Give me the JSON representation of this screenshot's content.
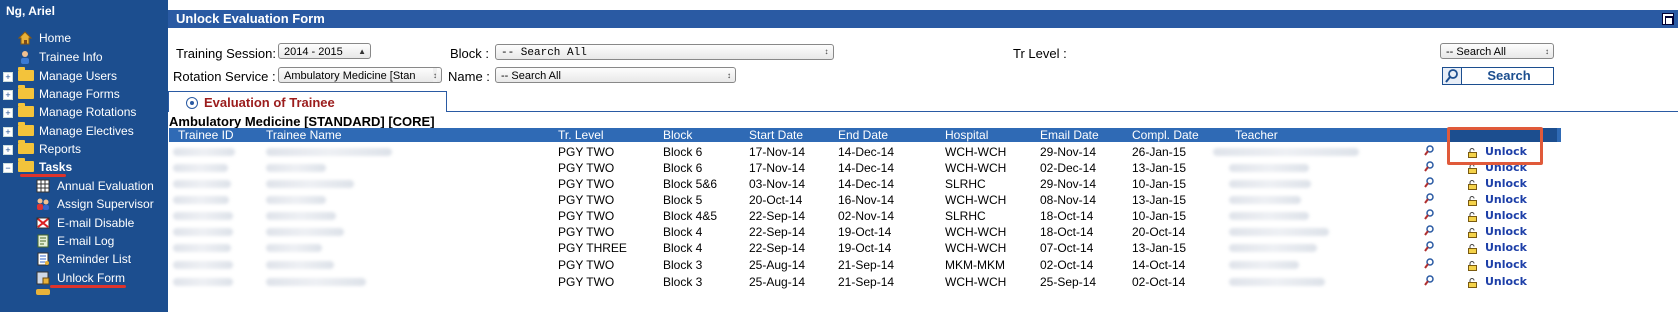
{
  "sidebar": {
    "user": "Ng, Ariel",
    "items": [
      {
        "label": "Home",
        "icon": "home-icon"
      },
      {
        "label": "Trainee Info",
        "icon": "person-icon"
      },
      {
        "label": "Manage Users",
        "icon": "folder-icon"
      },
      {
        "label": "Manage Forms",
        "icon": "folder-icon"
      },
      {
        "label": "Manage Rotations",
        "icon": "folder-icon"
      },
      {
        "label": "Manage Electives",
        "icon": "folder-icon"
      },
      {
        "label": "Reports",
        "icon": "folder-icon"
      },
      {
        "label": "Tasks",
        "icon": "folder-open-icon"
      },
      {
        "label": "Annual Evaluation",
        "icon": "grid-icon"
      },
      {
        "label": "Assign Supervisor",
        "icon": "users-icon"
      },
      {
        "label": "E-mail Disable",
        "icon": "mail-disable-icon"
      },
      {
        "label": "E-mail Log",
        "icon": "log-icon"
      },
      {
        "label": "Reminder List",
        "icon": "list-icon"
      },
      {
        "label": "Unlock Form",
        "icon": "unlock-form-icon"
      }
    ]
  },
  "title": "Unlock Evaluation Form",
  "filters": {
    "training_session_label": "Training Session:",
    "training_session_value": "2014 - 2015",
    "block_label": "Block :",
    "block_value": "-- Search All",
    "tr_level_label": "Tr Level :",
    "tr_level_value": "-- Search All",
    "rotation_service_label": "Rotation Service :",
    "rotation_service_value": "Ambulatory Medicine [Stan",
    "name_label": "Name :",
    "name_value": "-- Search All",
    "search_label": "Search"
  },
  "tab": {
    "label": "Evaluation of Trainee"
  },
  "section_title": "Ambulatory Medicine [STANDARD] [CORE]",
  "columns": [
    "Trainee ID",
    "Trainee Name",
    "Tr. Level",
    "Block",
    "Start Date",
    "End Date",
    "Hospital",
    "Email Date",
    "Compl. Date",
    "Teacher"
  ],
  "unlock_label": "Unlock",
  "rows": [
    {
      "level": "PGY TWO",
      "block": "Block 6",
      "start": "17-Nov-14",
      "end": "14-Dec-14",
      "hospital": "WCH-WCH",
      "email": "29-Nov-14",
      "compl": "26-Jan-15"
    },
    {
      "level": "PGY TWO",
      "block": "Block 6",
      "start": "17-Nov-14",
      "end": "14-Dec-14",
      "hospital": "WCH-WCH",
      "email": "02-Dec-14",
      "compl": "13-Jan-15"
    },
    {
      "level": "PGY TWO",
      "block": "Block 5&6",
      "start": "03-Nov-14",
      "end": "14-Dec-14",
      "hospital": "SLRHC",
      "email": "29-Nov-14",
      "compl": "10-Jan-15"
    },
    {
      "level": "PGY TWO",
      "block": "Block 5",
      "start": "20-Oct-14",
      "end": "16-Nov-14",
      "hospital": "WCH-WCH",
      "email": "08-Nov-14",
      "compl": "13-Jan-15"
    },
    {
      "level": "PGY TWO",
      "block": "Block 4&5",
      "start": "22-Sep-14",
      "end": "02-Nov-14",
      "hospital": "SLRHC",
      "email": "18-Oct-14",
      "compl": "10-Jan-15"
    },
    {
      "level": "PGY TWO",
      "block": "Block 4",
      "start": "22-Sep-14",
      "end": "19-Oct-14",
      "hospital": "WCH-WCH",
      "email": "18-Oct-14",
      "compl": "20-Oct-14"
    },
    {
      "level": "PGY THREE",
      "block": "Block 4",
      "start": "22-Sep-14",
      "end": "19-Oct-14",
      "hospital": "WCH-WCH",
      "email": "07-Oct-14",
      "compl": "13-Jan-15"
    },
    {
      "level": "PGY TWO",
      "block": "Block 3",
      "start": "25-Aug-14",
      "end": "21-Sep-14",
      "hospital": "MKM-MKM",
      "email": "02-Oct-14",
      "compl": "14-Oct-14"
    },
    {
      "level": "PGY TWO",
      "block": "Block 3",
      "start": "25-Aug-14",
      "end": "21-Sep-14",
      "hospital": "WCH-WCH",
      "email": "25-Sep-14",
      "compl": "02-Oct-14"
    }
  ]
}
